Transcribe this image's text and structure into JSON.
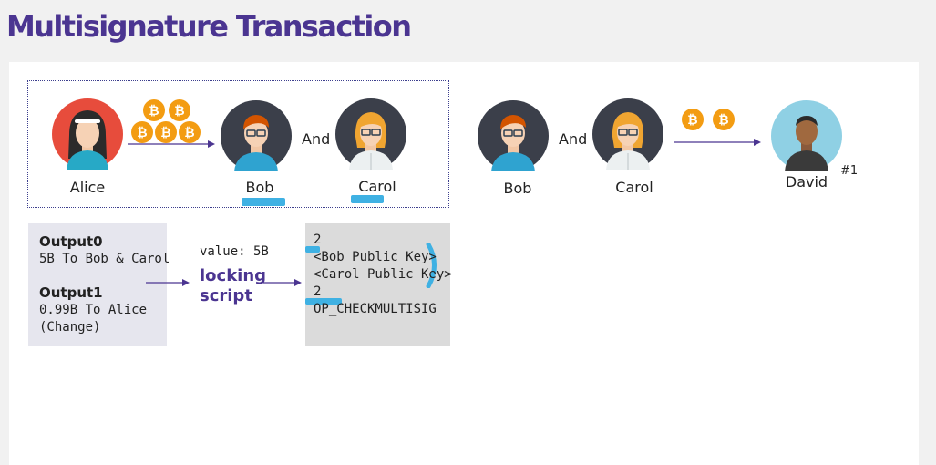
{
  "page": {
    "title": "Multisignature Transaction"
  },
  "diagram": {
    "group": {
      "sender_name": "Alice",
      "recipient1_name": "Bob",
      "and_text": "And",
      "recipient2_name": "Carol"
    },
    "spend": {
      "signer1_name": "Bob",
      "and_text": "And",
      "signer2_name": "Carol",
      "receiver_name": "David",
      "marker": "#1"
    },
    "coins": {
      "sent_count": 5,
      "spent_count": 2
    }
  },
  "transaction": {
    "output0_label": "Output0",
    "output0_detail": "5B To Bob & Carol",
    "output1_label": "Output1",
    "output1_detail": "0.99B To Alice",
    "output1_note": "(Change)"
  },
  "locking": {
    "value": "value: 5B",
    "label_line1": "locking",
    "label_line2": "script"
  },
  "script": {
    "lines": [
      "2",
      "<Bob Public Key>",
      "<Carol Public Key>",
      "2",
      "OP_CHECKMULTISIG"
    ]
  },
  "colors": {
    "title": "#4b3591",
    "highlight": "#3fb1e3",
    "coin": "#f39c12",
    "arrow": "#4b3591"
  }
}
